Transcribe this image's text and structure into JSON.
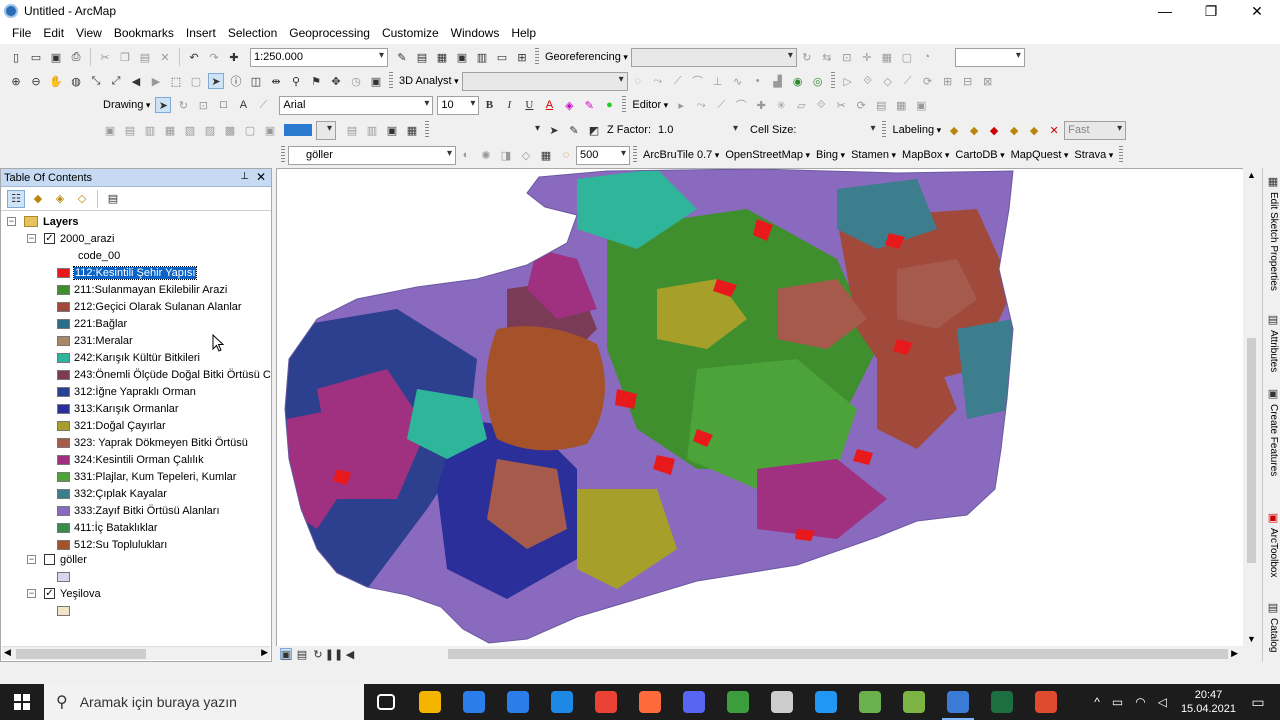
{
  "window": {
    "title": "Untitled - ArcMap",
    "minimize": "—",
    "maximize": "❐",
    "close": "✕"
  },
  "menu": [
    "File",
    "Edit",
    "View",
    "Bookmarks",
    "Insert",
    "Selection",
    "Geoprocessing",
    "Customize",
    "Windows",
    "Help"
  ],
  "toolbar": {
    "scale": "1:250.000",
    "georeferencing": "Georeferencing",
    "analyst3d": "3D Analyst",
    "drawing": "Drawing",
    "font": "Arial",
    "font_size": "10",
    "bold": "B",
    "italic": "I",
    "underline": "U",
    "editor": "Editor",
    "z_factor_label": "Z Factor:",
    "z_factor_value": "1.0",
    "cell_size_label": "Cell Size:",
    "labeling": "Labeling",
    "fast": "Fast",
    "layer": "göller",
    "effect_value": "500",
    "basemaps": [
      "ArcBruTile 0.7",
      "OpenStreetMap",
      "Bing",
      "Stamen",
      "MapBox",
      "CartoDB",
      "MapQuest",
      "Strava"
    ]
  },
  "toc": {
    "title": "Table Of Contents",
    "pin": "⊥",
    "close": "✕",
    "layers_label": "Layers",
    "groups": [
      {
        "name": "2000_arazi",
        "checked": true,
        "field": "code_00",
        "classes": [
          {
            "label": "112:Kesintili Şehir Yapısı",
            "color": "#e8191b",
            "selected": true
          },
          {
            "label": "211:Sulanmayan Ekilebilir Arazi",
            "color": "#3f8f2f"
          },
          {
            "label": "212:Geçici Olarak Sulanan Alanlar",
            "color": "#a14a3c"
          },
          {
            "label": "221:Bağlar",
            "color": "#2c6e8a"
          },
          {
            "label": "231:Meralar",
            "color": "#a7896a"
          },
          {
            "label": "242:Karışık Kültür Bitkileri",
            "color": "#2fb59a"
          },
          {
            "label": "243:Önemli Ölçüde Doğal Bitki Örtüsü C",
            "color": "#7a3b56"
          },
          {
            "label": "312:İğne Yapraklı Orman",
            "color": "#2d3f8f"
          },
          {
            "label": "313:Karışık Ormanlar",
            "color": "#2a2f9a"
          },
          {
            "label": "321:Doğal Çayırlar",
            "color": "#a6a02a"
          },
          {
            "label": "323: Yaprak Dökmeyen Bitki Örtüsü",
            "color": "#a65a4c"
          },
          {
            "label": "324:Kesintili Orman Çalılık",
            "color": "#a03080"
          },
          {
            "label": "331:Plajlar, Kum Tepeleri, Kumlar",
            "color": "#4ba33a"
          },
          {
            "label": "332:Çıplak Kayalar",
            "color": "#3c7e8e"
          },
          {
            "label": "333:Zayıf Bitki Örtüsü Alanları",
            "color": "#8a6abf"
          },
          {
            "label": "411:İç Bataklıklar",
            "color": "#3a8a4a"
          },
          {
            "label": "512:Su Toplulukları",
            "color": "#a5522a"
          }
        ]
      },
      {
        "name": "göller",
        "checked": false,
        "swatch": "#d8d4f4"
      },
      {
        "name": "Yeşilova",
        "checked": true,
        "swatch": "#f5e3c8"
      }
    ]
  },
  "rightdock": [
    "Edit Sketch Properties",
    "Attributes",
    "Create Features",
    "ArcToolbox",
    "Catalog"
  ],
  "taskbar": {
    "search_placeholder": "Aramak için buraya yazın",
    "time": "20:47",
    "date": "15.04.2021",
    "app_colors": [
      "#ffffff",
      "#f4b400",
      "#2b7de9",
      "#2b7de9",
      "#1e88e5",
      "#ea4335",
      "#ff6a3d",
      "#5865f2",
      "#3c9d3c",
      "#cccccc",
      "#2196f3",
      "#6ab04c",
      "#7cb342",
      "#3a7bd5",
      "#1d6f42",
      "#e04a2f"
    ]
  },
  "colors": {
    "water": "#a5522a",
    "forest_dark": "#2d3f8f",
    "forest_mixed": "#2a2f9a",
    "sparse": "#8a6abf",
    "agri": "#3f8f2f",
    "shrub": "#a03080",
    "meadow": "#a6a02a",
    "mixed_crop": "#2fb59a",
    "urban": "#e8191b",
    "temp_irr": "#a14a3c",
    "nat_veg": "#7a3b56",
    "rock": "#3c7e8e"
  }
}
